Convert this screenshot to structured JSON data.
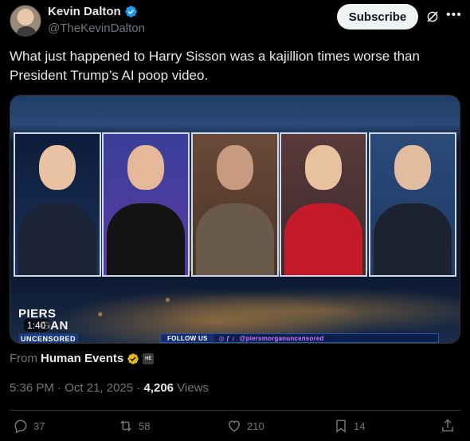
{
  "author": {
    "name": "Kevin Dalton",
    "handle": "@TheKevinDalton",
    "verified_color": "#1d9bf0"
  },
  "header": {
    "subscribe_label": "Subscribe",
    "grok_icon": "grok-icon",
    "more_icon": "more-icon"
  },
  "tweet": {
    "text": "What just happened to Harry Sisson was a kajillion times worse than President Trump’s AI poop video."
  },
  "media": {
    "duration": "1:40",
    "show_logo": {
      "line1": "PIERS",
      "line2": "GAN",
      "line3": "UNCENSORED"
    },
    "follow_label": "FOLLOW US",
    "follow_handle": "@piersmorganuncensored",
    "panel_count": 5
  },
  "source": {
    "prefix": "From",
    "org": "Human Events",
    "badge_text": "HE",
    "gold_check_color": "#e2b719"
  },
  "meta": {
    "time": "5:36 PM",
    "separator": "·",
    "date": "Oct 21, 2025",
    "views_count": "4,206",
    "views_label": "Views"
  },
  "actions": {
    "replies": "37",
    "reposts": "58",
    "likes": "210",
    "bookmarks": "14"
  }
}
